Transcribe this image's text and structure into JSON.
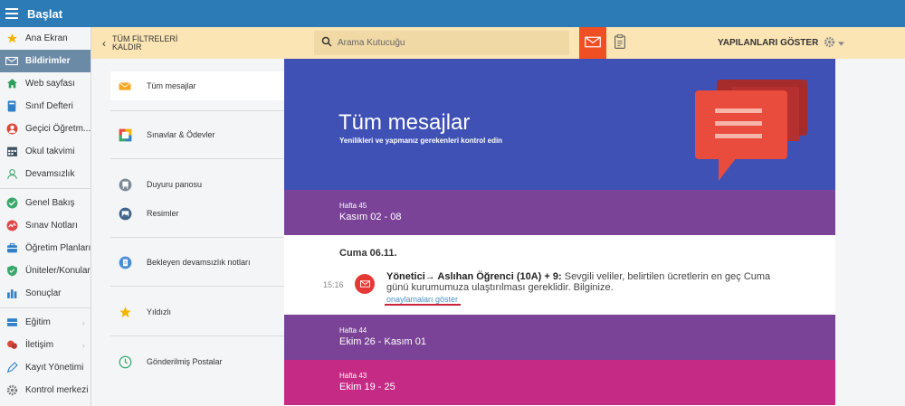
{
  "topbar": {
    "title": "Başlat"
  },
  "sidebar": {
    "items": [
      {
        "label": "Ana Ekran",
        "icon": "star-icon"
      },
      {
        "label": "Bildirimler",
        "icon": "envelope-icon"
      },
      {
        "label": "Web sayfası",
        "icon": "home-icon"
      },
      {
        "label": "Sınıf Defteri",
        "icon": "book-icon"
      },
      {
        "label": "Geçici Öğretm...",
        "icon": "person-badge-icon"
      },
      {
        "label": "Okul takvimi",
        "icon": "calendar-icon"
      },
      {
        "label": "Devamsızlık",
        "icon": "person-outline-icon"
      },
      {
        "label": "Genel Bakış",
        "icon": "check-circle-icon"
      },
      {
        "label": "Sınav Notları",
        "icon": "chart-circle-icon"
      },
      {
        "label": "Öğretim Planları",
        "icon": "briefcase-icon"
      },
      {
        "label": "Üniteler/Konular",
        "icon": "shield-icon"
      },
      {
        "label": "Sonuçlar",
        "icon": "bar-chart-icon"
      },
      {
        "label": "Eğitim",
        "icon": "books-icon"
      },
      {
        "label": "İletişim",
        "icon": "chat-icon"
      },
      {
        "label": "Kayıt Yönetimi",
        "icon": "pen-icon"
      },
      {
        "label": "Kontrol merkezi",
        "icon": "gear-icon"
      }
    ]
  },
  "filterbar": {
    "back_label_1": "TÜM FİLTRELERİ",
    "back_label_2": "KALDIR",
    "search_placeholder": "Arama Kutucuğu",
    "show_done_label": "YAPILANLARI GÖSTER"
  },
  "folders": [
    {
      "label": "Tüm mesajlar",
      "icon": "envelope-icon"
    },
    {
      "label": "Sınavlar & Ödevler",
      "icon": "colorful-square-icon"
    },
    {
      "label": "Duyuru panosu",
      "icon": "board-icon"
    },
    {
      "label": "Resimler",
      "icon": "image-icon"
    },
    {
      "label": "Bekleyen devamsızlık notları",
      "icon": "clipboard-icon"
    },
    {
      "label": "Yıldızlı",
      "icon": "star-icon"
    },
    {
      "label": "Gönderilmiş Postalar",
      "icon": "sent-clock-icon"
    }
  ],
  "hero": {
    "title": "Tüm mesajlar",
    "subtitle": "Yenilikleri ve yapmanız gerekenleri kontrol edin"
  },
  "weeks": [
    {
      "week": "Hafta 45",
      "range": "Kasım 02 - 08"
    },
    {
      "week": "Hafta 44",
      "range": "Ekim 26 - Kasım 01"
    },
    {
      "week": "Hafta 43",
      "range": "Ekim 19 - 25"
    }
  ],
  "day": {
    "label": "Cuma 06.11.",
    "message": {
      "time": "15:16",
      "sender": "Yönetici→ Aslıhan Öğrenci (10A) + 9:",
      "text": " Sevgili veliler, belirtilen ücretlerin en geç Cuma günü kurumumuza ulaştırılması gereklidir. Bilginize.",
      "link": "onaylamaları göster"
    }
  },
  "colors": {
    "topbar": "#2c7bb6",
    "filterbar": "#fce5b5",
    "accent_orange": "#f04e23",
    "hero": "#3f51b5",
    "week_purple": "#7b4397",
    "week_pink": "#c52a85"
  }
}
